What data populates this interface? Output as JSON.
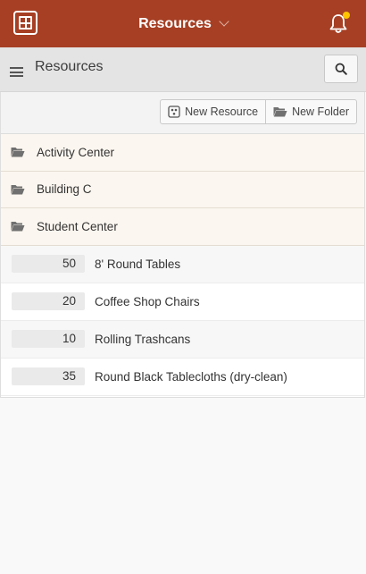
{
  "header": {
    "title": "Resources",
    "accent_color": "#a63f24",
    "notification_dot_color": "#ffc400"
  },
  "subheader": {
    "title": "Resources"
  },
  "toolbar": {
    "new_resource_label": "New Resource",
    "new_folder_label": "New Folder"
  },
  "folders": [
    {
      "label": "Activity Center"
    },
    {
      "label": "Building C"
    },
    {
      "label": "Student Center"
    }
  ],
  "resources": [
    {
      "quantity": "50",
      "name": "8' Round Tables"
    },
    {
      "quantity": "20",
      "name": "Coffee Shop Chairs"
    },
    {
      "quantity": "10",
      "name": "Rolling Trashcans"
    },
    {
      "quantity": "35",
      "name": "Round Black Tablecloths (dry-clean)"
    }
  ]
}
